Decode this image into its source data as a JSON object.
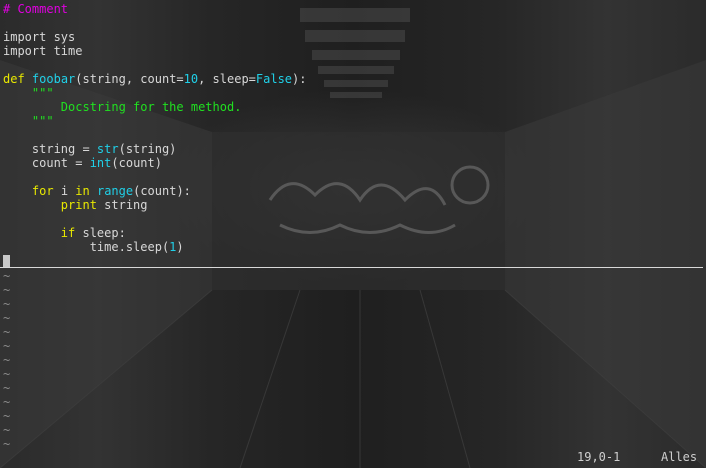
{
  "editor": {
    "lines": [
      [
        {
          "text": "# Comment",
          "cls": "comment"
        }
      ],
      [],
      [
        {
          "text": "import",
          "cls": "plain"
        },
        {
          "text": " sys",
          "cls": "plain"
        }
      ],
      [
        {
          "text": "import",
          "cls": "plain"
        },
        {
          "text": " time",
          "cls": "plain"
        }
      ],
      [],
      [
        {
          "text": "def",
          "cls": "keyword"
        },
        {
          "text": " ",
          "cls": "plain"
        },
        {
          "text": "foobar",
          "cls": "funcname"
        },
        {
          "text": "(string, count=",
          "cls": "plain"
        },
        {
          "text": "10",
          "cls": "number"
        },
        {
          "text": ", sleep=",
          "cls": "plain"
        },
        {
          "text": "False",
          "cls": "const"
        },
        {
          "text": "):",
          "cls": "plain"
        }
      ],
      [
        {
          "text": "    \"\"\"",
          "cls": "string"
        }
      ],
      [
        {
          "text": "        Docstring for the method.",
          "cls": "string"
        }
      ],
      [
        {
          "text": "    \"\"\"",
          "cls": "string"
        }
      ],
      [],
      [
        {
          "text": "    string = ",
          "cls": "plain"
        },
        {
          "text": "str",
          "cls": "builtin"
        },
        {
          "text": "(string)",
          "cls": "plain"
        }
      ],
      [
        {
          "text": "    count = ",
          "cls": "plain"
        },
        {
          "text": "int",
          "cls": "builtin"
        },
        {
          "text": "(count)",
          "cls": "plain"
        }
      ],
      [],
      [
        {
          "text": "    ",
          "cls": "plain"
        },
        {
          "text": "for",
          "cls": "keyword"
        },
        {
          "text": " i ",
          "cls": "plain"
        },
        {
          "text": "in",
          "cls": "keyword"
        },
        {
          "text": " ",
          "cls": "plain"
        },
        {
          "text": "range",
          "cls": "builtin"
        },
        {
          "text": "(count):",
          "cls": "plain"
        }
      ],
      [
        {
          "text": "        ",
          "cls": "plain"
        },
        {
          "text": "print",
          "cls": "keyword"
        },
        {
          "text": " string",
          "cls": "plain"
        }
      ],
      [],
      [
        {
          "text": "        ",
          "cls": "plain"
        },
        {
          "text": "if",
          "cls": "keyword"
        },
        {
          "text": " sleep:",
          "cls": "plain"
        }
      ],
      [
        {
          "text": "            time.sleep(",
          "cls": "plain"
        },
        {
          "text": "1",
          "cls": "number"
        },
        {
          "text": ")",
          "cls": "plain"
        }
      ]
    ],
    "empty_line_marker": "~",
    "empty_line_count": 13
  },
  "statusline": {
    "position": "19,0-1",
    "scope": "Alles"
  },
  "colors": {
    "comment": "#e000e0",
    "keyword": "#e8e800",
    "identifier": "#20d0e8",
    "string": "#20e020",
    "text": "#d8d8d8"
  }
}
